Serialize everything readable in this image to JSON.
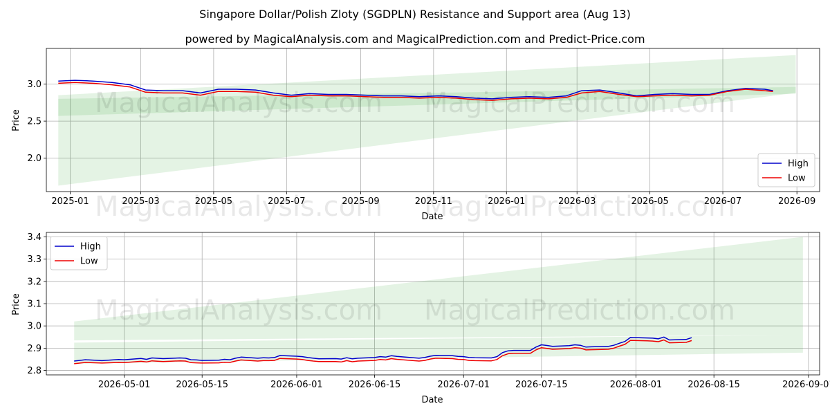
{
  "title": "Singapore Dollar/Polish Zloty (SGDPLN) Resistance and Support area (Aug 13)",
  "subtitle": "powered by MagicalAnalysis.com and MagicalPrediction.com and Predict-Price.com",
  "watermarks": [
    "MagicalAnalysis.com",
    "MagicalPrediction.com"
  ],
  "colors": {
    "high": "#0000cc",
    "low": "#ee0000",
    "band": "#2ca02c",
    "grid": "#b0b0b0"
  },
  "chart_data": [
    {
      "type": "line",
      "xlabel": "Date",
      "ylabel": "Price",
      "xlim": [
        "2024-12-12",
        "2026-09-20"
      ],
      "ylim": [
        1.55,
        3.48
      ],
      "xticks": [
        "2025-01-01",
        "2025-03-01",
        "2025-05-01",
        "2025-07-01",
        "2025-09-01",
        "2025-11-01",
        "2026-01-01",
        "2026-03-01",
        "2026-05-01",
        "2026-07-01",
        "2026-09-01"
      ],
      "xtick_labels": [
        "2025-01",
        "2025-03",
        "2025-05",
        "2025-07",
        "2025-09",
        "2025-11",
        "2026-01",
        "2026-03",
        "2026-05",
        "2026-07",
        "2026-09"
      ],
      "yticks": [
        2.0,
        2.5,
        3.0
      ],
      "ytick_labels": [
        "2.0",
        "2.5",
        "3.0"
      ],
      "legend": {
        "position": "lower-right",
        "entries": [
          "High",
          "Low"
        ]
      },
      "grid": true,
      "bands": [
        {
          "x": [
            "2024-12-22",
            "2026-08-31"
          ],
          "lower": [
            1.63,
            2.88
          ],
          "upper": [
            2.85,
            3.39
          ]
        },
        {
          "x": [
            "2024-12-22",
            "2026-08-31"
          ],
          "lower": [
            2.57,
            2.87
          ],
          "upper": [
            2.8,
            2.96
          ]
        }
      ],
      "series": [
        {
          "name": "High",
          "x": [
            "2024-12-22",
            "2025-01-05",
            "2025-01-20",
            "2025-02-05",
            "2025-02-20",
            "2025-03-05",
            "2025-03-20",
            "2025-04-05",
            "2025-04-20",
            "2025-05-05",
            "2025-05-20",
            "2025-06-05",
            "2025-06-20",
            "2025-07-05",
            "2025-07-20",
            "2025-08-05",
            "2025-08-20",
            "2025-09-05",
            "2025-09-20",
            "2025-10-05",
            "2025-10-20",
            "2025-11-05",
            "2025-11-20",
            "2025-12-05",
            "2025-12-20",
            "2026-01-05",
            "2026-01-20",
            "2026-02-05",
            "2026-02-20",
            "2026-03-05",
            "2026-03-20",
            "2026-04-05",
            "2026-04-20",
            "2026-05-05",
            "2026-05-20",
            "2026-06-05",
            "2026-06-20",
            "2026-07-05",
            "2026-07-20",
            "2026-08-05",
            "2026-08-12"
          ],
          "values": [
            3.04,
            3.05,
            3.04,
            3.02,
            2.99,
            2.92,
            2.91,
            2.91,
            2.88,
            2.93,
            2.93,
            2.92,
            2.88,
            2.85,
            2.87,
            2.86,
            2.86,
            2.85,
            2.84,
            2.84,
            2.83,
            2.84,
            2.83,
            2.81,
            2.8,
            2.82,
            2.83,
            2.82,
            2.84,
            2.91,
            2.92,
            2.88,
            2.84,
            2.86,
            2.87,
            2.86,
            2.86,
            2.91,
            2.94,
            2.93,
            2.91
          ]
        },
        {
          "name": "Low",
          "x": [
            "2024-12-22",
            "2025-01-05",
            "2025-01-20",
            "2025-02-05",
            "2025-02-20",
            "2025-03-05",
            "2025-03-20",
            "2025-04-05",
            "2025-04-20",
            "2025-05-05",
            "2025-05-20",
            "2025-06-05",
            "2025-06-20",
            "2025-07-05",
            "2025-07-20",
            "2025-08-05",
            "2025-08-20",
            "2025-09-05",
            "2025-09-20",
            "2025-10-05",
            "2025-10-20",
            "2025-11-05",
            "2025-11-20",
            "2025-12-05",
            "2025-12-20",
            "2026-01-05",
            "2026-01-20",
            "2026-02-05",
            "2026-02-20",
            "2026-03-05",
            "2026-03-20",
            "2026-04-05",
            "2026-04-20",
            "2026-05-05",
            "2026-05-20",
            "2026-06-05",
            "2026-06-20",
            "2026-07-05",
            "2026-07-20",
            "2026-08-05",
            "2026-08-12"
          ],
          "values": [
            3.01,
            3.02,
            3.01,
            2.99,
            2.96,
            2.89,
            2.88,
            2.88,
            2.85,
            2.9,
            2.9,
            2.89,
            2.85,
            2.83,
            2.85,
            2.84,
            2.84,
            2.83,
            2.82,
            2.82,
            2.81,
            2.82,
            2.81,
            2.79,
            2.78,
            2.8,
            2.81,
            2.8,
            2.82,
            2.88,
            2.9,
            2.86,
            2.83,
            2.84,
            2.85,
            2.84,
            2.85,
            2.9,
            2.93,
            2.91,
            2.9
          ]
        }
      ]
    },
    {
      "type": "line",
      "xlabel": "Date",
      "ylabel": "Price",
      "xlim": [
        "2026-04-17",
        "2026-09-03"
      ],
      "ylim": [
        2.78,
        3.42
      ],
      "xticks": [
        "2026-05-01",
        "2026-05-15",
        "2026-06-01",
        "2026-06-15",
        "2026-07-01",
        "2026-07-15",
        "2026-08-01",
        "2026-08-15",
        "2026-09-01"
      ],
      "xtick_labels": [
        "2026-05-01",
        "2026-05-15",
        "2026-06-01",
        "2026-06-15",
        "2026-07-01",
        "2026-07-15",
        "2026-08-01",
        "2026-08-15",
        "2026-09-01"
      ],
      "yticks": [
        2.8,
        2.9,
        3.0,
        3.1,
        3.2,
        3.3,
        3.4
      ],
      "ytick_labels": [
        "2.8",
        "2.9",
        "3.0",
        "3.1",
        "3.2",
        "3.3",
        "3.4"
      ],
      "legend": {
        "position": "upper-left",
        "entries": [
          "High",
          "Low"
        ]
      },
      "grid": true,
      "bands": [
        {
          "x": [
            "2026-04-22",
            "2026-08-31"
          ],
          "lower": [
            2.935,
            2.96
          ],
          "upper": [
            3.02,
            3.4
          ]
        },
        {
          "x": [
            "2026-04-22",
            "2026-08-31"
          ],
          "lower": [
            2.83,
            2.88
          ],
          "upper": [
            2.925,
            2.96
          ]
        }
      ],
      "series": [
        {
          "name": "High",
          "x": [
            "2026-04-22",
            "2026-04-24",
            "2026-04-27",
            "2026-04-30",
            "2026-05-01",
            "2026-05-04",
            "2026-05-05",
            "2026-05-06",
            "2026-05-08",
            "2026-05-11",
            "2026-05-12",
            "2026-05-13",
            "2026-05-14",
            "2026-05-15",
            "2026-05-18",
            "2026-05-19",
            "2026-05-20",
            "2026-05-21",
            "2026-05-22",
            "2026-05-25",
            "2026-05-26",
            "2026-05-27",
            "2026-05-28",
            "2026-05-29",
            "2026-06-01",
            "2026-06-02",
            "2026-06-03",
            "2026-06-04",
            "2026-06-05",
            "2026-06-08",
            "2026-06-09",
            "2026-06-10",
            "2026-06-11",
            "2026-06-12",
            "2026-06-15",
            "2026-06-16",
            "2026-06-17",
            "2026-06-18",
            "2026-06-19",
            "2026-06-22",
            "2026-06-23",
            "2026-06-24",
            "2026-06-25",
            "2026-06-26",
            "2026-06-29",
            "2026-06-30",
            "2026-07-01",
            "2026-07-02",
            "2026-07-03",
            "2026-07-06",
            "2026-07-07",
            "2026-07-08",
            "2026-07-09",
            "2026-07-10",
            "2026-07-13",
            "2026-07-14",
            "2026-07-15",
            "2026-07-16",
            "2026-07-17",
            "2026-07-20",
            "2026-07-21",
            "2026-07-22",
            "2026-07-23",
            "2026-07-24",
            "2026-07-27",
            "2026-07-28",
            "2026-07-29",
            "2026-07-30",
            "2026-07-31",
            "2026-08-03",
            "2026-08-04",
            "2026-08-05",
            "2026-08-06",
            "2026-08-07",
            "2026-08-10",
            "2026-08-11"
          ],
          "values": [
            2.842,
            2.848,
            2.844,
            2.849,
            2.848,
            2.854,
            2.85,
            2.856,
            2.853,
            2.856,
            2.855,
            2.848,
            2.847,
            2.845,
            2.846,
            2.85,
            2.848,
            2.855,
            2.86,
            2.855,
            2.857,
            2.856,
            2.858,
            2.867,
            2.864,
            2.862,
            2.858,
            2.855,
            2.852,
            2.853,
            2.851,
            2.857,
            2.852,
            2.855,
            2.858,
            2.862,
            2.86,
            2.866,
            2.863,
            2.857,
            2.855,
            2.858,
            2.864,
            2.868,
            2.866,
            2.863,
            2.862,
            2.858,
            2.857,
            2.856,
            2.862,
            2.88,
            2.888,
            2.89,
            2.89,
            2.905,
            2.915,
            2.912,
            2.908,
            2.911,
            2.915,
            2.913,
            2.905,
            2.906,
            2.908,
            2.913,
            2.922,
            2.93,
            2.948,
            2.946,
            2.945,
            2.942,
            2.95,
            2.937,
            2.939,
            2.947
          ]
        },
        {
          "name": "Low",
          "x": [
            "2026-04-22",
            "2026-04-24",
            "2026-04-27",
            "2026-04-30",
            "2026-05-01",
            "2026-05-04",
            "2026-05-05",
            "2026-05-06",
            "2026-05-08",
            "2026-05-11",
            "2026-05-12",
            "2026-05-13",
            "2026-05-14",
            "2026-05-15",
            "2026-05-18",
            "2026-05-19",
            "2026-05-20",
            "2026-05-21",
            "2026-05-22",
            "2026-05-25",
            "2026-05-26",
            "2026-05-27",
            "2026-05-28",
            "2026-05-29",
            "2026-06-01",
            "2026-06-02",
            "2026-06-03",
            "2026-06-04",
            "2026-06-05",
            "2026-06-08",
            "2026-06-09",
            "2026-06-10",
            "2026-06-11",
            "2026-06-12",
            "2026-06-15",
            "2026-06-16",
            "2026-06-17",
            "2026-06-18",
            "2026-06-19",
            "2026-06-22",
            "2026-06-23",
            "2026-06-24",
            "2026-06-25",
            "2026-06-26",
            "2026-06-29",
            "2026-06-30",
            "2026-07-01",
            "2026-07-02",
            "2026-07-03",
            "2026-07-06",
            "2026-07-07",
            "2026-07-08",
            "2026-07-09",
            "2026-07-10",
            "2026-07-13",
            "2026-07-14",
            "2026-07-15",
            "2026-07-16",
            "2026-07-17",
            "2026-07-20",
            "2026-07-21",
            "2026-07-22",
            "2026-07-23",
            "2026-07-24",
            "2026-07-27",
            "2026-07-28",
            "2026-07-29",
            "2026-07-30",
            "2026-07-31",
            "2026-08-03",
            "2026-08-04",
            "2026-08-05",
            "2026-08-06",
            "2026-08-07",
            "2026-08-10",
            "2026-08-11"
          ],
          "values": [
            2.83,
            2.836,
            2.833,
            2.836,
            2.835,
            2.841,
            2.838,
            2.843,
            2.84,
            2.843,
            2.842,
            2.835,
            2.834,
            2.833,
            2.834,
            2.837,
            2.836,
            2.842,
            2.847,
            2.842,
            2.844,
            2.844,
            2.845,
            2.854,
            2.851,
            2.849,
            2.845,
            2.842,
            2.84,
            2.84,
            2.838,
            2.844,
            2.839,
            2.842,
            2.845,
            2.849,
            2.847,
            2.853,
            2.85,
            2.844,
            2.842,
            2.845,
            2.851,
            2.855,
            2.853,
            2.85,
            2.849,
            2.845,
            2.844,
            2.843,
            2.849,
            2.866,
            2.875,
            2.877,
            2.877,
            2.892,
            2.902,
            2.899,
            2.895,
            2.898,
            2.902,
            2.9,
            2.892,
            2.893,
            2.895,
            2.9,
            2.909,
            2.917,
            2.935,
            2.933,
            2.932,
            2.929,
            2.937,
            2.924,
            2.926,
            2.934
          ]
        }
      ]
    }
  ]
}
